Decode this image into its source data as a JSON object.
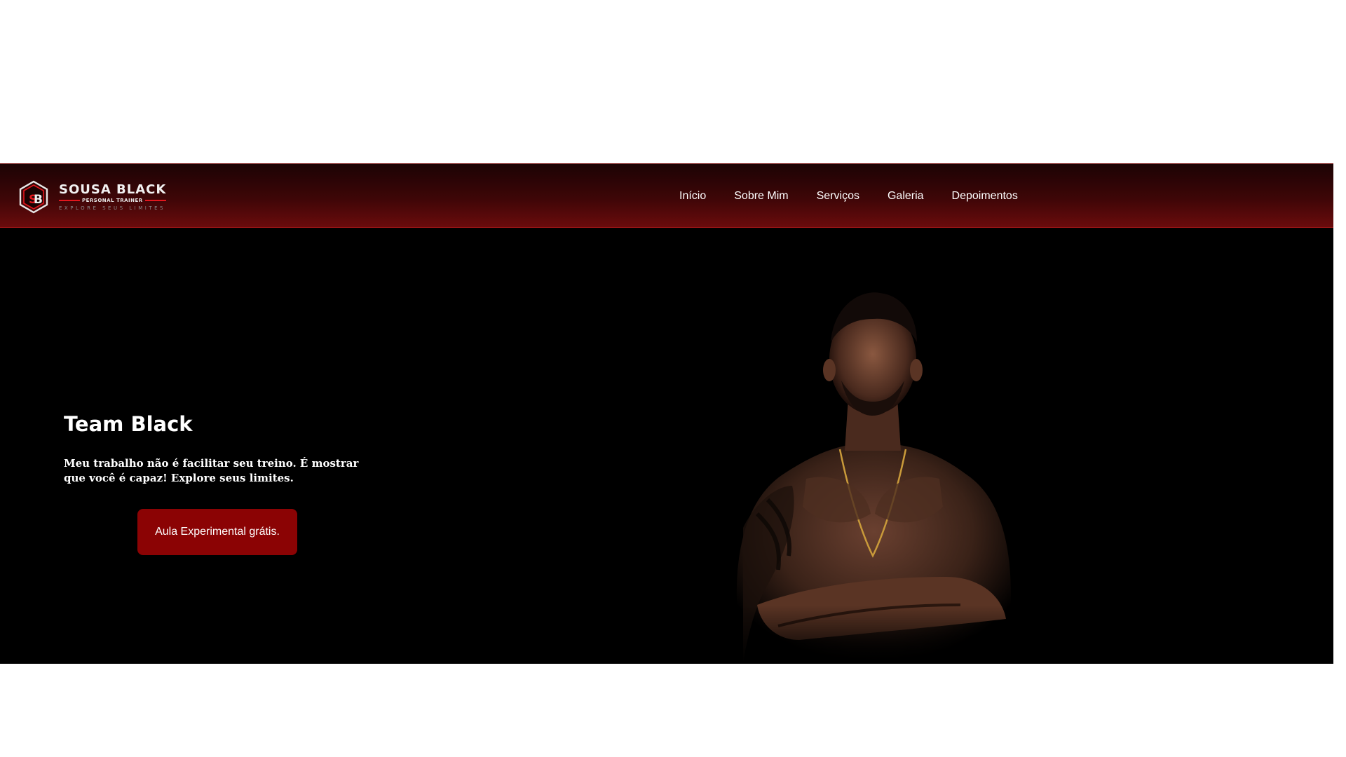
{
  "brand": {
    "name": "SOUSA BLACK",
    "subtitle": "PERSONAL TRAINER",
    "tagline": "EXPLORE SEUS LIMITES",
    "monogram": "SB",
    "accent_color": "#e3161d"
  },
  "nav": {
    "items": [
      {
        "label": "Início"
      },
      {
        "label": "Sobre Mim"
      },
      {
        "label": "Serviços"
      },
      {
        "label": "Galeria"
      },
      {
        "label": "Depoimentos"
      }
    ]
  },
  "hero": {
    "title": "Team Black",
    "description": "Meu trabalho não é facilitar seu treino. É mostrar que você é capaz! Explore seus limites.",
    "cta_label": "Aula Experimental grátis.",
    "cta_color": "#8b0304"
  }
}
